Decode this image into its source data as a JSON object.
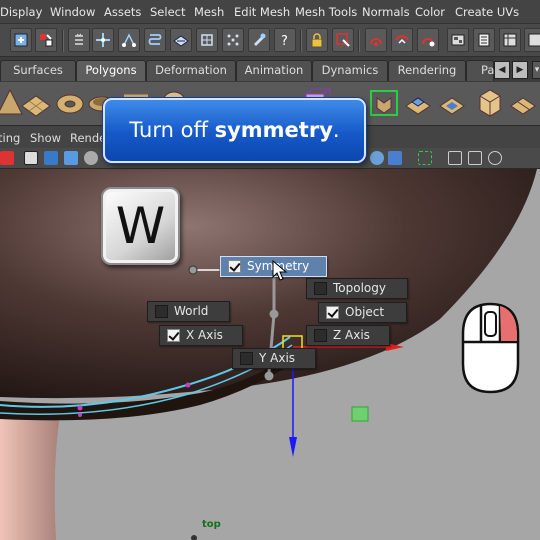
{
  "menubar": {
    "items": [
      "Display",
      "Window",
      "Assets",
      "Select",
      "Mesh",
      "Edit Mesh",
      "Mesh Tools",
      "Normals",
      "Color",
      "Create UVs"
    ]
  },
  "status_icons": [
    "move-tool-icon",
    "select-icon",
    "list-icon",
    "move-icon",
    "snap-curve-icon",
    "snap-point-icon",
    "snap-grid-icon",
    "snap-view-icon",
    "magnet-icon",
    "help-icon",
    "lock-icon",
    "select-object-icon",
    "render-icon",
    "ipr-render-icon",
    "render-settings-icon",
    "hypershade-icon",
    "panel-icon"
  ],
  "shelf_tabs": {
    "items": [
      "Surfaces",
      "Polygons",
      "Deformation",
      "Animation",
      "Dynamics",
      "Rendering",
      "Pa"
    ],
    "active": "Polygons"
  },
  "shelf_icons": [
    "cone-icon",
    "plane-icon",
    "torus-icon",
    "sphere-icon",
    "disc-icon",
    "cylinder-icon",
    "cube-icon",
    "bevel-icon",
    "bridge-icon",
    "extrude-icon",
    "fill-icon",
    "cube-wire-icon"
  ],
  "panel_menu": {
    "items": [
      "ting",
      "Show",
      "Rende"
    ]
  },
  "tooltip": {
    "prefix": "Turn off ",
    "bold": "symmetry",
    "suffix": "."
  },
  "key_hint": {
    "letter": "W"
  },
  "marking_menu": {
    "symmetry": {
      "label": "Symmetry",
      "checked": true,
      "highlighted": true
    },
    "topology": {
      "label": "Topology",
      "checked": false
    },
    "world": {
      "label": "World",
      "checked": false
    },
    "object": {
      "label": "Object",
      "checked": true
    },
    "x_axis": {
      "label": "X Axis",
      "checked": true
    },
    "z_axis": {
      "label": "Z Axis",
      "checked": false
    },
    "y_axis": {
      "label": "Y Axis",
      "checked": false
    }
  },
  "viewport": {
    "camera_label": "top",
    "background_color": "#a6a6a6",
    "model_color": "#4a3532",
    "selection_color": "#5ec8e8",
    "highlight_color": "#cfe0f5"
  },
  "mouse_hint": {
    "pressed_button": "right",
    "pressed_color": "#e86f6f"
  }
}
